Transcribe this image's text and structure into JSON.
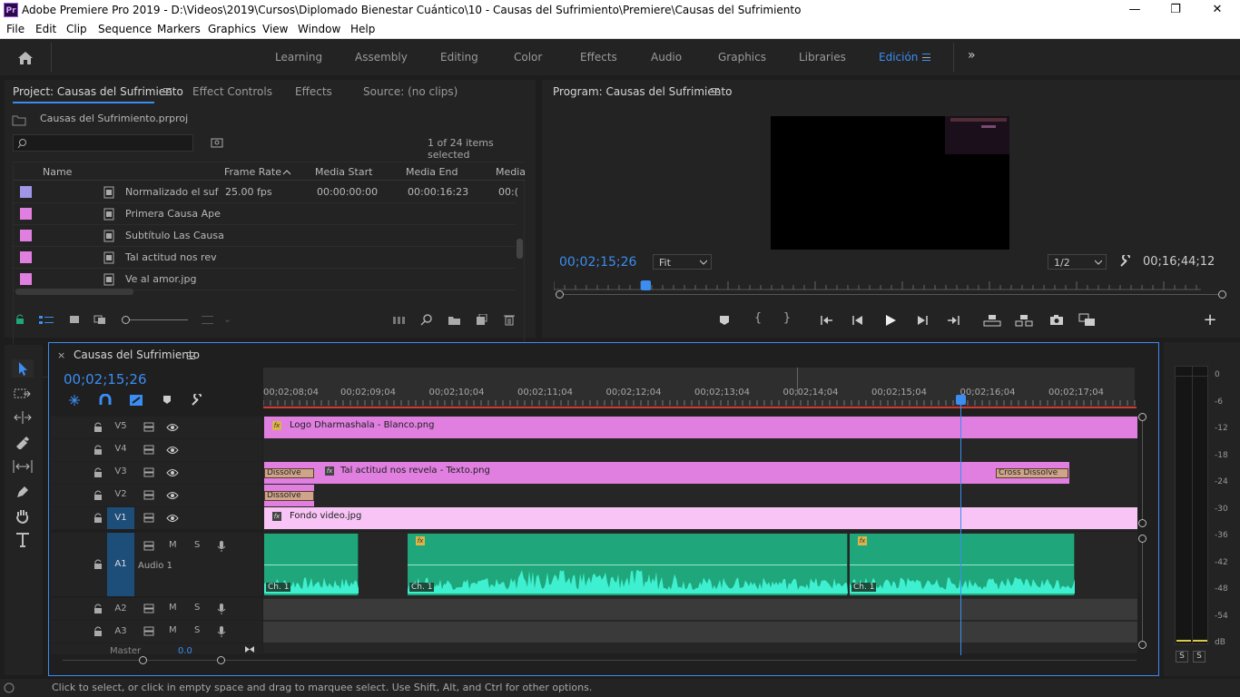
{
  "window": {
    "title": "Adobe Premiere Pro 2019 - D:\\Videos\\2019\\Cursos\\Diplomado Bienestar Cuántico\\10 - Causas del Sufrimiento\\Premiere\\Causas del Sufrimiento",
    "app_icon": "Pr",
    "minimize": "—",
    "restore": "❐",
    "close": "✕"
  },
  "menu": [
    "File",
    "Edit",
    "Clip",
    "Sequence",
    "Markers",
    "Graphics",
    "View",
    "Window",
    "Help"
  ],
  "workspaces": [
    "Learning",
    "Assembly",
    "Editing",
    "Color",
    "Effects",
    "Audio",
    "Graphics",
    "Libraries",
    "Edición"
  ],
  "workspaces_active": "Edición",
  "workspaces_more": "»",
  "project": {
    "tabs": [
      "Project: Causas del Sufrimiento",
      "Effect Controls",
      "Effects",
      "Source: (no clips)"
    ],
    "file": "Causas del Sufrimiento.prproj",
    "items_selected": "1 of 24 items selected",
    "columns": [
      "Name",
      "Frame Rate",
      "Media Start",
      "Media End",
      "Media"
    ],
    "rows": [
      {
        "color": "#9f96e8",
        "name": "Normalizado el suf",
        "frame_rate": "25.00 fps",
        "media_start": "00:00:00:00",
        "media_end": "00:00:16:23",
        "media": "00:("
      },
      {
        "color": "#e07fe0",
        "name": "Primera Causa Ape",
        "frame_rate": "",
        "media_start": "",
        "media_end": "",
        "media": ""
      },
      {
        "color": "#e07fe0",
        "name": "Subtítulo Las Causa",
        "frame_rate": "",
        "media_start": "",
        "media_end": "",
        "media": ""
      },
      {
        "color": "#e07fe0",
        "name": "Tal actitud nos rev",
        "frame_rate": "",
        "media_start": "",
        "media_end": "",
        "media": ""
      },
      {
        "color": "#e07fe0",
        "name": "Ve al amor.jpg",
        "frame_rate": "",
        "media_start": "",
        "media_end": "",
        "media": ""
      }
    ]
  },
  "program": {
    "title": "Program: Causas del Sufrimiento",
    "timecode": "00;02;15;26",
    "fit": "Fit",
    "resolution": "1/2",
    "duration": "00;16;44;12",
    "playhead_fraction": 0.135
  },
  "timeline": {
    "title": "Causas del Sufrimiento",
    "timecode": "00;02;15;26",
    "ruler": [
      "00;02;08;04",
      "00;02;09;04",
      "00;02;10;04",
      "00;02;11;04",
      "00;02;12;04",
      "00;02;13;04",
      "00;02;14;04",
      "00;02;15;04",
      "00;02;16;04",
      "00;02;17;04"
    ],
    "video_tracks": [
      "V5",
      "V4",
      "V3",
      "V2",
      "V1"
    ],
    "audio_tracks": [
      "A1",
      "A2",
      "A3"
    ],
    "audio1_name": "Audio 1",
    "master_label": "Master",
    "master_value": "0.0",
    "track_m": "M",
    "track_s": "S",
    "clips": {
      "v5": "Logo Dharmashala - Blanco.png",
      "v3": "Tal actitud nos revela - Texto.png",
      "v1": "Fondo video.jpg",
      "dissolve_a": "Dissolve",
      "dissolve_b": "Dissolve",
      "cross_dissolve": "Cross Dissolve",
      "channel": "Ch. 1",
      "fx": "fx"
    }
  },
  "meter": {
    "scale": [
      "0",
      "-6",
      "-12",
      "-18",
      "-24",
      "-30",
      "-36",
      "-42",
      "-48",
      "-54",
      "dB"
    ],
    "solo": [
      "S",
      "S"
    ]
  },
  "status": "Click to select, or click in empty space and drag to marquee select. Use Shift, Alt, and Ctrl for other options.",
  "colors": {
    "accent": "#3b8df2",
    "video_clip": "#e07fe0",
    "v1_clip": "#f7c4f5",
    "audio_clip": "#1fa67a",
    "waveform": "#3ef0d0"
  }
}
